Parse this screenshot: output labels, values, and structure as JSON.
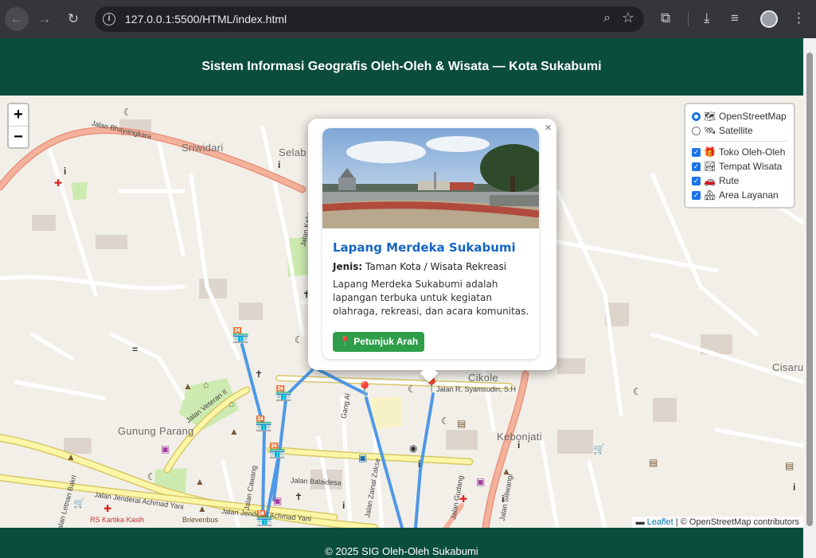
{
  "browser": {
    "url": "127.0.0.1:5500/HTML/index.html"
  },
  "header": {
    "title": "Sistem Informasi Geografis Oleh-Oleh & Wisata — Kota Sukabumi"
  },
  "map": {
    "zoom_in": "+",
    "zoom_out": "−",
    "labels": {
      "sriwidari": "Sriwidari",
      "selab": "Selab",
      "gunung_parang": "Gunung Parang",
      "cikole": "Cikole",
      "kebonjati": "Kebonjati",
      "cisaru": "Cisaru",
      "jalan_bhayangkara": "Jalan Bhayangkara",
      "jalan_veteran": "Jalan Veteran II",
      "jalan_ahmad_yani": "Jalan Jenderal Achmad Yani",
      "jalan_balaidesa": "Jalan Balaidesa",
      "jalan_syamsudin": "Jalan R. Syamsudin, S.H",
      "jalan_gudang": "Jalan Gudang",
      "jalan_siliwangi": "Jalan Siliwangi",
      "rs_kartika": "RS Kartika Kasih",
      "brievenbus": "Brievenbus",
      "jalan_letnan": "Jalan Letnan Bakri",
      "jalan_cawang": "Jalan Cawang",
      "jalan_zainal": "Jalan Zainal Zakse",
      "jalan_gang": "Gang Al",
      "jalan_kebon": "Jalan Kebon"
    }
  },
  "layer_control": {
    "base_layers": [
      {
        "label": "OpenStreetMap",
        "icon": "map-icon",
        "checked": true
      },
      {
        "label": "Satellite",
        "icon": "satellite-icon",
        "checked": false
      }
    ],
    "overlays": [
      {
        "label": "Toko Oleh-Oleh",
        "icon": "gift-icon",
        "checked": true
      },
      {
        "label": "Tempat Wisata",
        "icon": "park-icon",
        "checked": true
      },
      {
        "label": "Rute",
        "icon": "car-icon",
        "checked": true
      },
      {
        "label": "Area Layanan",
        "icon": "house-icon",
        "checked": true
      }
    ]
  },
  "popup": {
    "close": "×",
    "title": "Lapang Merdeka Sukabumi",
    "type_label": "Jenis:",
    "type_value": "Taman Kota / Wisata Rekreasi",
    "description": "Lapang Merdeka Sukabumi adalah lapangan terbuka untuk kegiatan olahraga, rekreasi, dan acara komunitas.",
    "button": "Petunjuk Arah"
  },
  "attribution": {
    "leaflet": "Leaflet",
    "separator": " | © OpenStreetMap contributors"
  },
  "footer": {
    "text": "© 2025 SIG Oleh-Oleh Sukabumi"
  }
}
